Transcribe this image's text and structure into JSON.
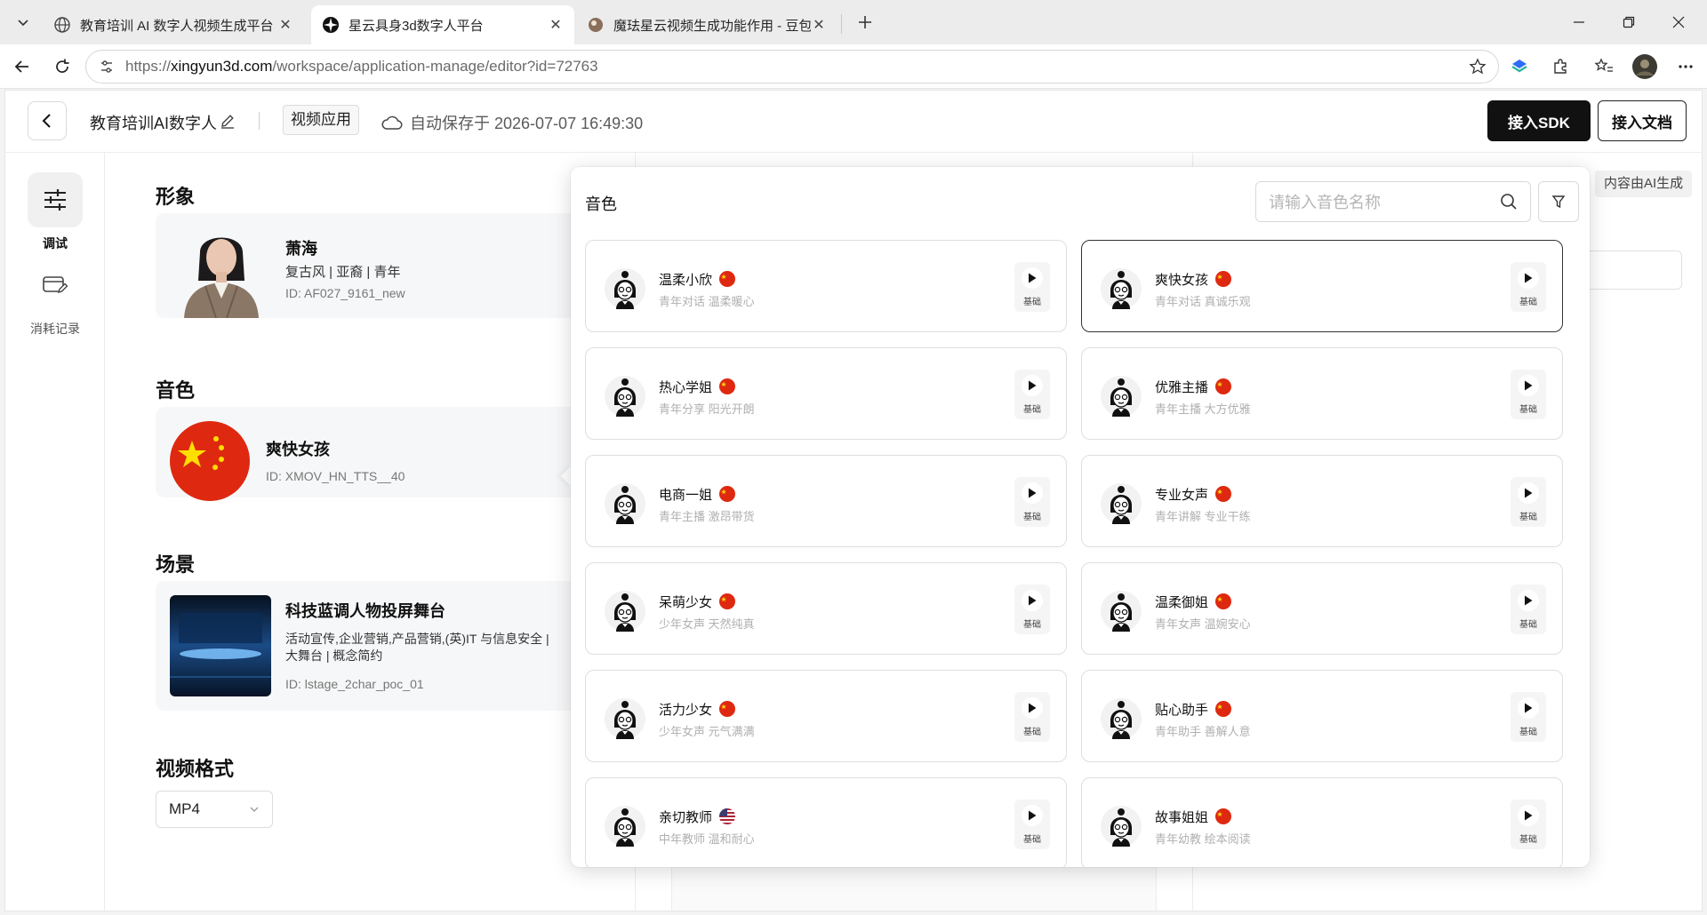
{
  "browser": {
    "tabs": [
      {
        "title": "教育培训 AI 数字人视频生成平台",
        "icon": "globe-icon"
      },
      {
        "title": "星云具身3d数字人平台",
        "icon": "nebula-logo-icon"
      },
      {
        "title": "魔珐星云视频生成功能作用 - 豆包",
        "icon": "doubao-icon"
      }
    ],
    "url_prefix": "https://",
    "url_host": "xingyun3d.com",
    "url_path": "/workspace/application-manage/editor?id=72763"
  },
  "header": {
    "app_name": "教育培训AI数字人",
    "type_tag": "视频应用",
    "save_status": "自动保存于 2026-07-07 16:49:30",
    "sdk_button": "接入SDK",
    "doc_button": "接入文档"
  },
  "nav": [
    {
      "label": "调试",
      "icon": "sliders-icon",
      "active": true
    },
    {
      "label": "消耗记录",
      "icon": "credit-card-edit-icon",
      "active": false
    }
  ],
  "config": {
    "avatar_title": "形象",
    "avatar": {
      "name": "萧海",
      "desc": "复古风 | 亚裔 | 青年",
      "id": "ID: AF027_9161_new"
    },
    "voice_title": "音色",
    "voice": {
      "name": "爽快女孩",
      "id": "ID: XMOV_HN_TTS__40"
    },
    "scene_title": "场景",
    "scene": {
      "name": "科技蓝调人物投屏舞台",
      "desc": "活动宣传,企业营销,产品营销,(英)IT 与信息安全 | 大舞台 | 概念简约",
      "id": "ID: lstage_2char_poc_01"
    },
    "format_title": "视频格式",
    "format_value": "MP4"
  },
  "right_panel": {
    "ai_tag": "内容由AI生成"
  },
  "popover": {
    "title": "音色",
    "search_placeholder": "请输入音色名称",
    "badge": "基础",
    "voices": [
      {
        "name": "温柔小欣",
        "tags": "青年对话 温柔暖心",
        "flag": "cn"
      },
      {
        "name": "爽快女孩",
        "tags": "青年对话 真诚乐观",
        "flag": "cn",
        "selected": true
      },
      {
        "name": "热心学姐",
        "tags": "青年分享 阳光开朗",
        "flag": "cn"
      },
      {
        "name": "优雅主播",
        "tags": "青年主播 大方优雅",
        "flag": "cn"
      },
      {
        "name": "电商一姐",
        "tags": "青年主播 激昂带货",
        "flag": "cn"
      },
      {
        "name": "专业女声",
        "tags": "青年讲解 专业干练",
        "flag": "cn"
      },
      {
        "name": "呆萌少女",
        "tags": "少年女声 天然纯真",
        "flag": "cn"
      },
      {
        "name": "温柔御姐",
        "tags": "青年女声 温婉安心",
        "flag": "cn"
      },
      {
        "name": "活力少女",
        "tags": "少年女声 元气满满",
        "flag": "cn"
      },
      {
        "name": "贴心助手",
        "tags": "青年助手 善解人意",
        "flag": "cn"
      },
      {
        "name": "亲切教师",
        "tags": "中年教师 温和耐心",
        "flag": "us"
      },
      {
        "name": "故事姐姐",
        "tags": "青年幼教 绘本阅读",
        "flag": "cn"
      }
    ]
  },
  "colors": {
    "accent": "#111111",
    "flag_red": "#de2910",
    "flag_yellow": "#ffde00"
  }
}
